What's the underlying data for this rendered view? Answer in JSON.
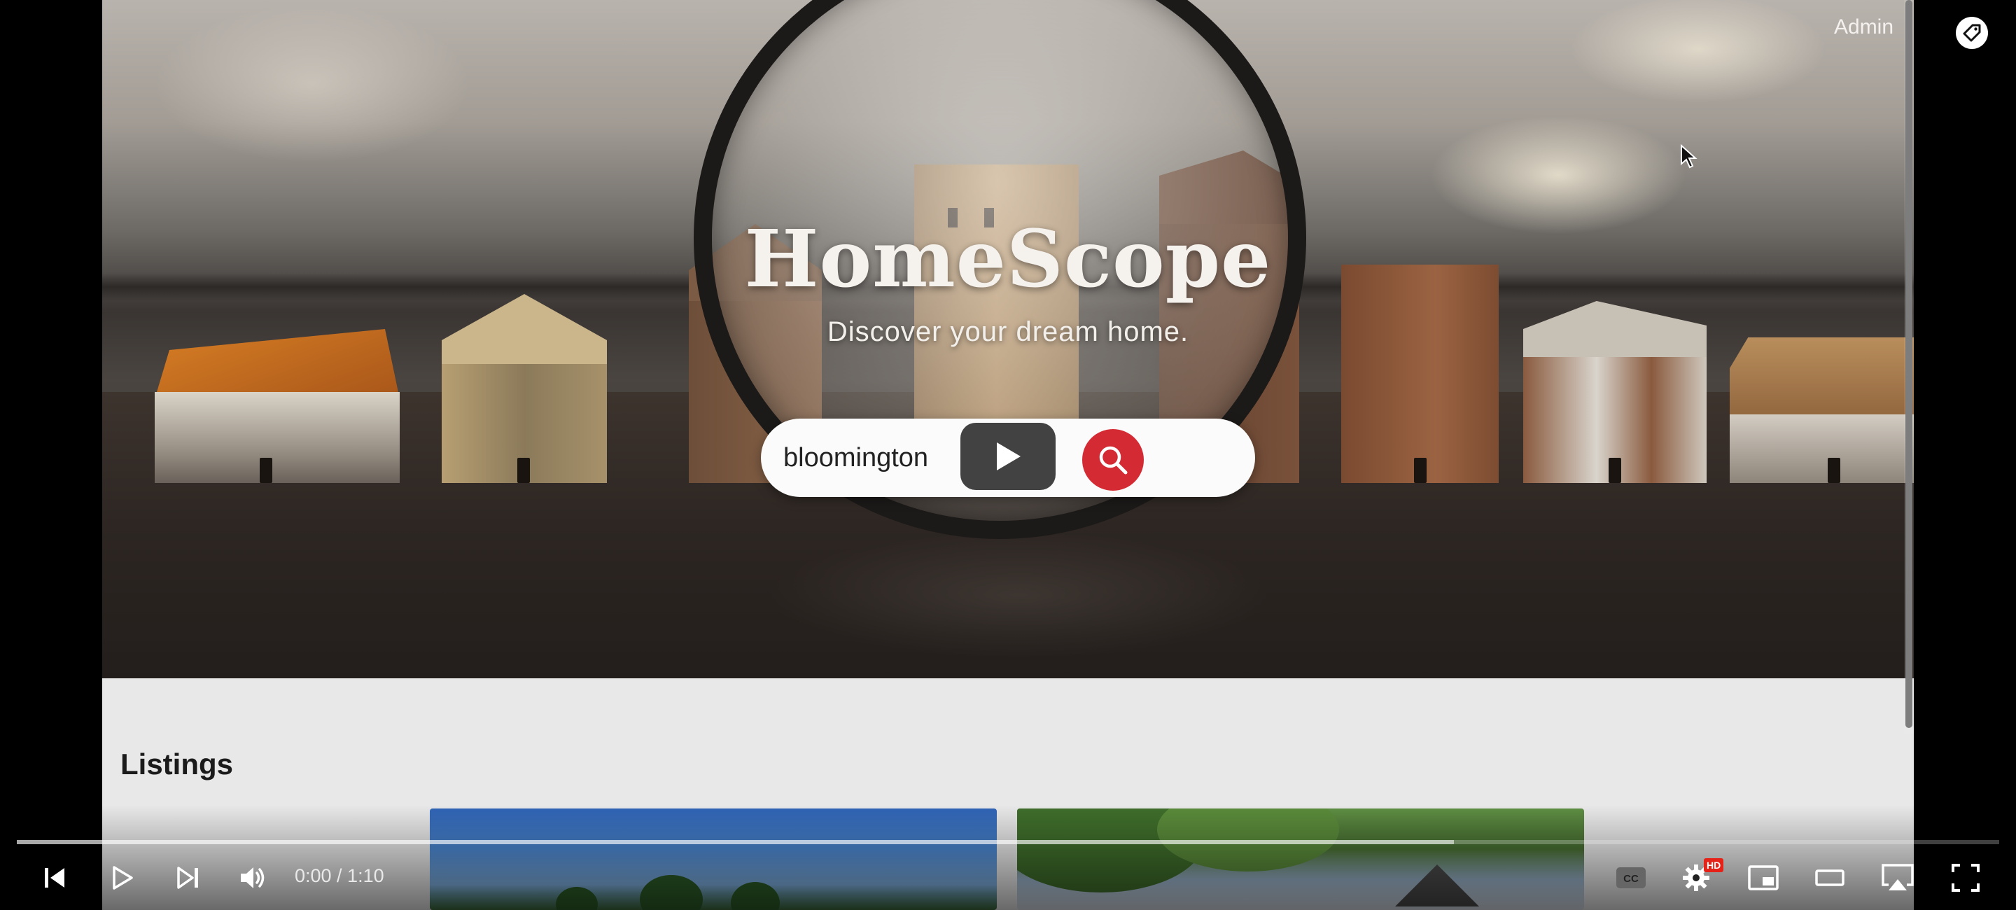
{
  "header": {
    "admin_label": "Admin"
  },
  "hero": {
    "brand": "HomeScope",
    "tagline": "Discover your dream home."
  },
  "search": {
    "value": "bloomington",
    "button_icon": "search-icon"
  },
  "listings": {
    "title": "Listings"
  },
  "player": {
    "time": "0:00 / 1:10",
    "progress_fraction": 0,
    "loaded_fraction": 0.725,
    "hd_badge": "HD",
    "icons": [
      "skip-previous-icon",
      "play-icon",
      "skip-next-icon",
      "volume-icon",
      "captions-icon",
      "settings-icon",
      "miniplayer-icon",
      "theater-mode-icon",
      "airplay-icon",
      "fullscreen-icon"
    ]
  },
  "colors": {
    "accent": "#d42a33",
    "hd": "#e62117"
  }
}
